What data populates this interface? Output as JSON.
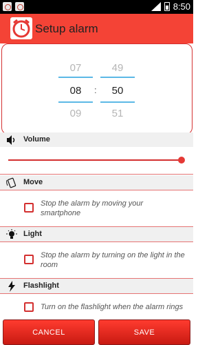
{
  "status_bar": {
    "time": "8:50"
  },
  "app": {
    "title": "Setup alarm"
  },
  "picker": {
    "hours": [
      "07",
      "08",
      "09"
    ],
    "minutes": [
      "49",
      "50",
      "51"
    ],
    "separator": ":"
  },
  "volume": {
    "label": "Volume",
    "level_fraction": 1.0
  },
  "sections": [
    {
      "label": "Move",
      "icon": "phone-shake-icon",
      "option": "Stop the alarm by moving your smartphone",
      "checked": false
    },
    {
      "label": "Light",
      "icon": "lightbulb-icon",
      "option": "Stop the alarm by turning on the light in the room",
      "checked": false
    },
    {
      "label": "Flashlight",
      "icon": "flashlight-icon",
      "option": "Turn on the flashlight when the alarm rings",
      "checked": false
    }
  ],
  "buttons": {
    "cancel": "CANCEL",
    "save": "SAVE"
  },
  "colors": {
    "accent": "#f44336",
    "picker_line": "#5bb8e6",
    "status_bar": "#000000"
  }
}
